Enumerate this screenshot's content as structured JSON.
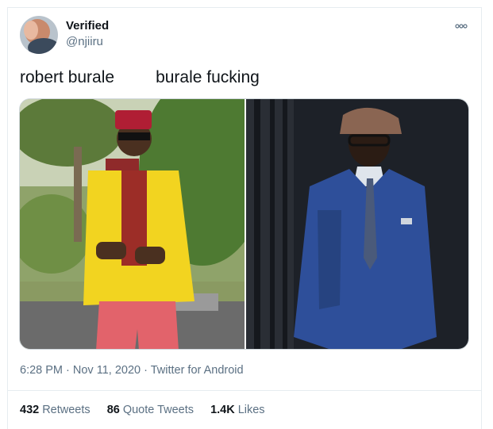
{
  "author": {
    "display_name": "Verified",
    "handle": "@njiiru"
  },
  "tweet": {
    "text_left": "robert burale",
    "text_right": "burale fucking"
  },
  "media": {
    "left_photo_icon": "man-in-yellow-blazer-photo",
    "right_photo_icon": "man-in-blue-suit-photo"
  },
  "meta": {
    "time": "6:28 PM",
    "sep1": " · ",
    "date": "Nov 11, 2020",
    "sep2": " · ",
    "source": "Twitter for Android"
  },
  "stats": {
    "retweets_count": "432",
    "retweets_label": "Retweets",
    "quotes_count": "86",
    "quotes_label": "Quote Tweets",
    "likes_count": "1.4K",
    "likes_label": "Likes"
  },
  "colors": {
    "text_primary": "#0f1419",
    "text_secondary": "#5b7083",
    "divider": "#e6ecf0"
  }
}
